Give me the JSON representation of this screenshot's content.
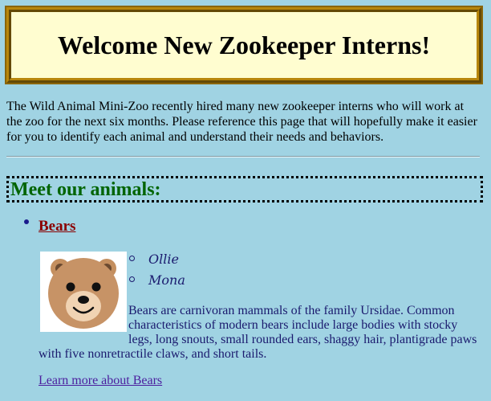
{
  "banner": {
    "title": "Welcome New Zookeeper Interns!"
  },
  "intro": {
    "text": "The Wild Animal Mini-Zoo recently hired many new zookeeper interns who will work at the zoo for the next six months. Please reference this page that will hopefully make it easier for you to identify each animal and understand their needs and behaviors."
  },
  "section": {
    "heading": "Meet our animals:"
  },
  "animals": [
    {
      "name": "Bears",
      "image_icon": "bear-face-icon",
      "individuals": [
        "Ollie",
        "Mona"
      ],
      "description_line1": "Bears are carnivoran mammals of the family Ursidae. Common characteristics of modern bears include large bodies with stocky legs, long snouts, small rounded ears, shaggy hair, plantigrade paws",
      "description_line2": "with five nonretractile claws, and short tails.",
      "learn_more": "Learn more about Bears"
    }
  ],
  "colors": {
    "background": "#a0d3e3",
    "banner_fill": "#fffdd0",
    "banner_border": "#b8860b",
    "heading_green": "#006400",
    "animal_link": "#8b0000",
    "body_text": "#1a1a6e",
    "visited_link": "#4b1e9e"
  }
}
